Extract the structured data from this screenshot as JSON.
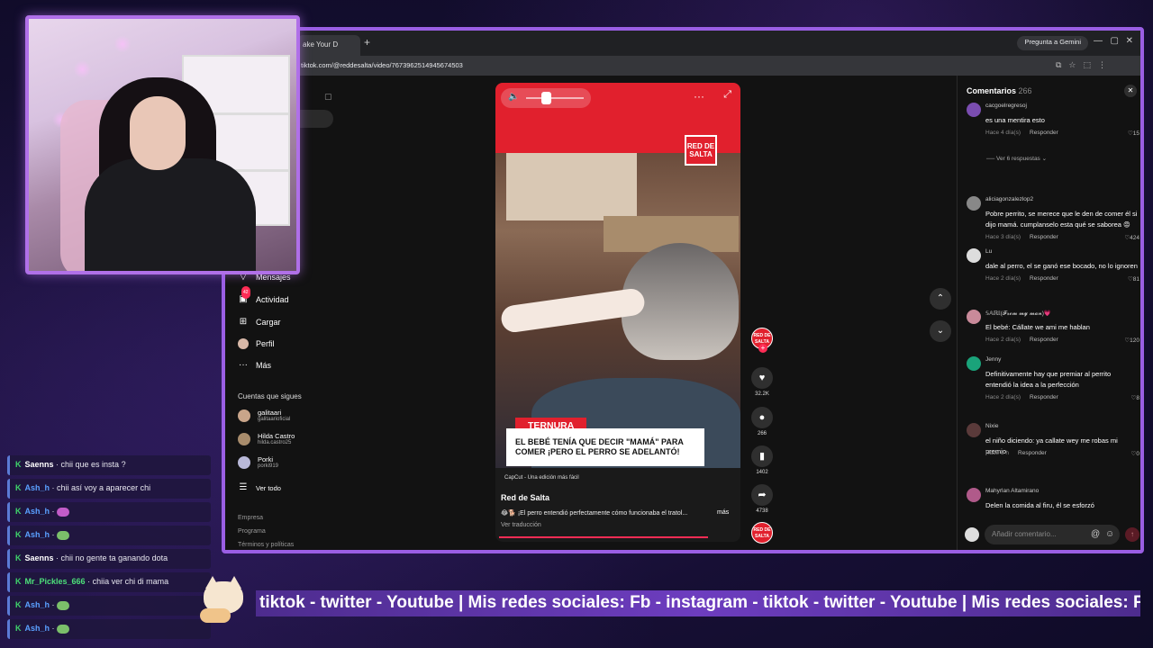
{
  "browser": {
    "tab_title": "ake Your D",
    "new_tab": "+",
    "gemini_button": "Pregunta a Gemini",
    "url": "tiktok.com/@reddesalta/video/7673962514945674503",
    "window_controls": [
      "—",
      "▢",
      "✕"
    ]
  },
  "sidebar": {
    "partial_item": "Mensajes",
    "items": [
      {
        "label": "Actividad",
        "icon": "bell-icon",
        "badge": "42"
      },
      {
        "label": "Cargar",
        "icon": "upload-icon"
      },
      {
        "label": "Perfil",
        "icon": "profile-icon"
      },
      {
        "label": "Más",
        "icon": "more-icon"
      }
    ],
    "following_title": "Cuentas que sigues",
    "accounts": [
      {
        "name": "galitaari",
        "handle": "galitaarioficial"
      },
      {
        "name": "Hilda Castro",
        "handle": "hilda.castro25"
      },
      {
        "name": "Porki",
        "handle": "porki919"
      }
    ],
    "see_all": "Ver todo",
    "footer": [
      "Empresa",
      "Programa",
      "Términos y políticas"
    ]
  },
  "video": {
    "logo_text": "RED DE SALTA",
    "tag": "TERNURA",
    "headline": "EL BEBÉ TENÍA QUE DECIR \"MAMÁ\" PARA COMER ¡PERO EL PERRO SE ADELANTÓ!",
    "capcut": "CapCut - Una edición más fácil",
    "author": "Red de Salta",
    "description": "😂🐕 ¡El perro entendió perfectamente cómo funcionaba el tratol...",
    "more": "más",
    "translate": "Ver traducción",
    "volume_level": 0.35,
    "progress": 0.88
  },
  "actions": {
    "likes": "32.2K",
    "comments": "266",
    "saves": "1402",
    "shares": "4738"
  },
  "comments": {
    "title": "Comentarios",
    "count": "266",
    "reply_label": "Responder",
    "view_replies": "Ver 6 respuestas",
    "input_placeholder": "Añadir comentario...",
    "items": [
      {
        "user": "cacgoelregresoj",
        "text": "es una mentira esto",
        "time": "Hace 4 día(s)",
        "likes": "15",
        "avatar_color": "#7a4db0"
      },
      {
        "user": "aliciagonzalezlop2",
        "text": "Pobre perrito, se merece que le den de comer él si dijo mamá. cumplanselo esta qué se saborea 😡",
        "time": "Hace 3 día(s)",
        "likes": "424",
        "avatar_color": "#888888"
      },
      {
        "user": "Lu",
        "text": "dale al perro, el se ganó ese bocado, no lo ignoren",
        "time": "Hace 2 día(s)",
        "likes": "81",
        "avatar_color": "#dddddd"
      },
      {
        "user": "𝕊𝔸ℝ𝕀(𝓕𝓻𝓸𝓶 𝓶𝔂 𝓶𝓪𝓷)💗",
        "text": "El bebé: Cállate we ami me hablan",
        "time": "Hace 2 día(s)",
        "likes": "120",
        "avatar_color": "#c98a9a"
      },
      {
        "user": "Jenny",
        "text": "Definitivamente hay que premiar al perrito entendió la idea a la perfección",
        "time": "Hace 2 día(s)",
        "likes": "8",
        "avatar_color": "#1aa37a"
      },
      {
        "user": "Nixie",
        "text": "el niño diciendo: ya callate wey me robas mi premio",
        "time": "Hace 5 h",
        "likes": "0",
        "avatar_color": "#5a3a3a"
      },
      {
        "user": "Mahyrlan Altamirano",
        "text": "Delen la comida al firu, él se esforzó",
        "time": "",
        "likes": "",
        "avatar_color": "#b05a8a"
      }
    ]
  },
  "chat": {
    "messages": [
      {
        "user": "Saenns",
        "text": "· chii que es insta ?",
        "color": "#ffffff",
        "emote": ""
      },
      {
        "user": "Ash_h",
        "text": "· chii así voy a aparecer chi",
        "color": "#5aa0ff",
        "emote": ""
      },
      {
        "user": "Ash_h",
        "text": "·",
        "color": "#5aa0ff",
        "emote": "p"
      },
      {
        "user": "Ash_h",
        "text": "·",
        "color": "#5aa0ff",
        "emote": "g"
      },
      {
        "user": "Saenns",
        "text": "· chii no gente ta ganando dota",
        "color": "#ffffff",
        "emote": ""
      },
      {
        "user": "Mr_Pickles_666",
        "text": "· chiia ver chi di mama",
        "color": "#4de07a",
        "emote": ""
      },
      {
        "user": "Ash_h",
        "text": "·",
        "color": "#5aa0ff",
        "emote": "g"
      },
      {
        "user": "Ash_h",
        "text": "·",
        "color": "#5aa0ff",
        "emote": "g"
      }
    ]
  },
  "ticker": {
    "text": "tiktok - twitter - Youtube   |   Mis redes sociales: Fb - instagram - tiktok - twitter - Youtube   |   Mis redes sociales: Fb"
  }
}
